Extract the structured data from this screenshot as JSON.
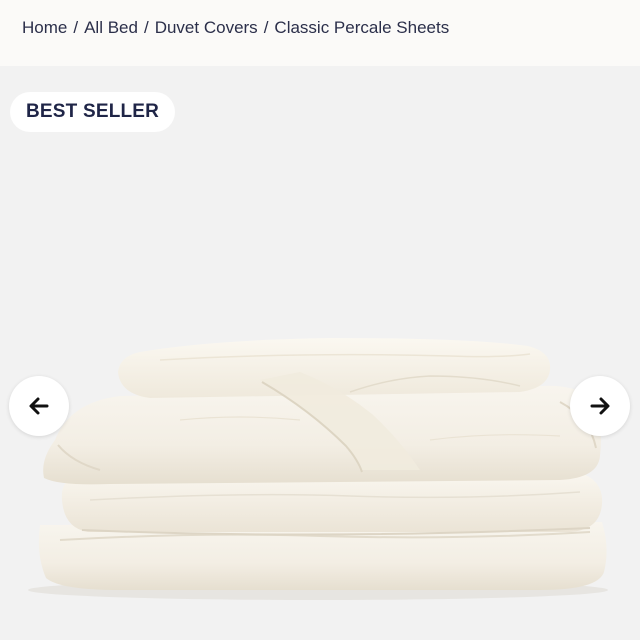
{
  "breadcrumb": {
    "items": [
      "Home",
      "All Bed",
      "Duvet Covers",
      "Classic Percale Sheets"
    ],
    "separator": "/"
  },
  "badge": {
    "label": "BEST SELLER"
  },
  "carousel": {
    "prev_icon": "arrow-left-icon",
    "next_icon": "arrow-right-icon"
  },
  "product_image": {
    "subject": "folded white duvet cover"
  },
  "colors": {
    "text_navy": "#2b2f4a",
    "badge_text": "#1f2547",
    "background": "#f2f2f2",
    "topbar": "#fbfaf8",
    "fabric": "#f7f3ea"
  }
}
